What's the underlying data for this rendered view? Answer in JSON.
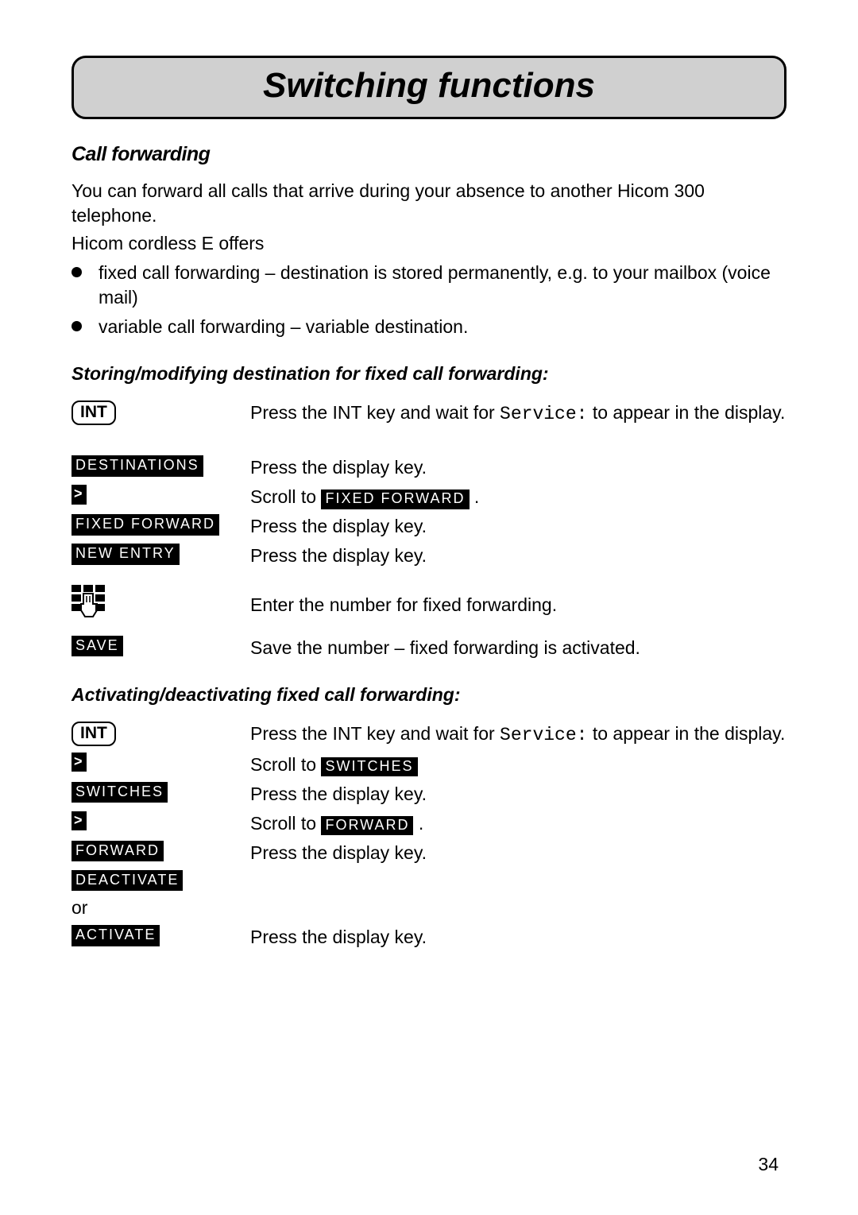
{
  "title": "Switching functions",
  "section_heading": "Call forwarding",
  "intro_line1": "You can forward all calls that arrive during your absence to another Hicom 300 telephone.",
  "intro_line2": "Hicom cordless E offers",
  "bullets": [
    "fixed call forwarding – destination is stored permanently, e.g. to your mailbox (voice mail)",
    "variable call forwarding – variable destination."
  ],
  "subheading1": "Storing/modifying destination for fixed call forwarding:",
  "keys": {
    "int": "INT",
    "destinations": "DESTINATIONS",
    "arrow": ">",
    "fixed_forward": "FIXED FORWARD",
    "new_entry": "NEW ENTRY",
    "save": "SAVE",
    "switches": "SWITCHES",
    "forward": "FORWARD",
    "deactivate": "DEACTIVATE",
    "activate": "ACTIVATE"
  },
  "steps1": {
    "int_pre": "Press the INT key and wait for ",
    "service": "Service:",
    "int_post": " to appear in the display.",
    "destinations": "Press the display key.",
    "scroll_pre": "Scroll to ",
    "scroll_target1": "FIXED FORWARD",
    "scroll_post": " .",
    "fixed_forward": "Press the display key.",
    "new_entry": "Press the display key.",
    "keypad": "Enter the number for fixed forwarding.",
    "save": "Save the number – fixed forwarding is activated."
  },
  "subheading2": "Activating/deactivating fixed call forwarding:",
  "steps2": {
    "int_pre": "Press the INT key and wait for ",
    "service": "Service:",
    "int_post": " to appear in the display.",
    "scroll_pre1": "Scroll to ",
    "scroll_target1": "SWITCHES",
    "switches": "Press the display key.",
    "scroll_pre2": "Scroll to ",
    "scroll_target2": "FORWARD",
    "scroll_post2": " .",
    "forward": "Press the display key.",
    "or": "or",
    "activate": "Press the display key."
  },
  "page_number": "34"
}
